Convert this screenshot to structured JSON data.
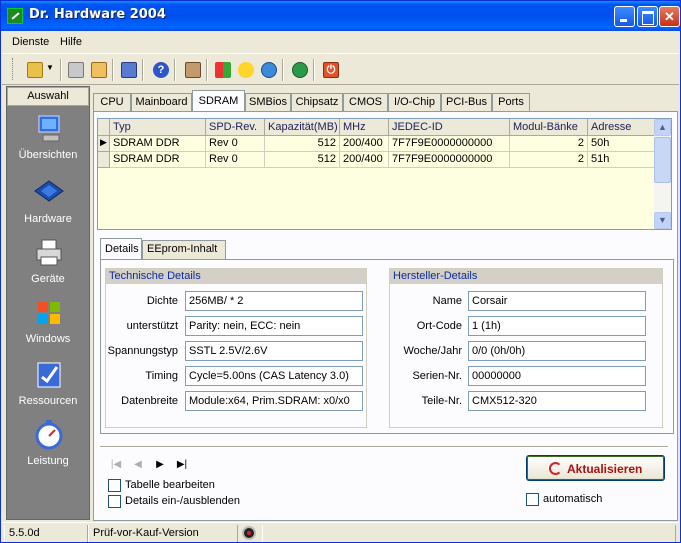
{
  "window": {
    "title": "Dr. Hardware 2004"
  },
  "menu": {
    "items": [
      "Dienste",
      "Hilfe"
    ]
  },
  "toolbar": {
    "buttons": [
      "folder-icon",
      "print-icon",
      "printer-setup-icon",
      "notes-icon",
      "help-icon",
      "tools-icon",
      "windows-icon",
      "sun-icon",
      "globe-icon",
      "network-icon",
      "power-icon"
    ]
  },
  "sidebar": {
    "header": "Auswahl",
    "items": [
      {
        "label": "Übersichten",
        "icon": "computer-icon"
      },
      {
        "label": "Hardware",
        "icon": "chip-icon"
      },
      {
        "label": "Geräte",
        "icon": "printer-icon"
      },
      {
        "label": "Windows",
        "icon": "windows-logo-icon"
      },
      {
        "label": "Ressourcen",
        "icon": "resources-icon"
      },
      {
        "label": "Leistung",
        "icon": "stopwatch-icon"
      }
    ]
  },
  "tabs": [
    "CPU",
    "Mainboard",
    "SDRAM",
    "SMBios",
    "Chipsatz",
    "CMOS",
    "I/O-Chip",
    "PCI-Bus",
    "Ports"
  ],
  "active_tab": "SDRAM",
  "table": {
    "columns": [
      "Typ",
      "SPD-Rev.",
      "Kapazität(MB)",
      "MHz",
      "JEDEC-ID",
      "Modul-Bänke",
      "Adresse"
    ],
    "rows": [
      [
        "SDRAM DDR",
        "Rev 0",
        "512",
        "200/400",
        "7F7F9E0000000000",
        "2",
        "50h"
      ],
      [
        "SDRAM DDR",
        "Rev 0",
        "512",
        "200/400",
        "7F7F9E0000000000",
        "2",
        "51h"
      ]
    ]
  },
  "subtabs": [
    "Details",
    "EEprom-Inhalt"
  ],
  "technical": {
    "title": "Technische Details",
    "fields": [
      {
        "label": "Dichte",
        "value": "256MB/ * 2"
      },
      {
        "label": "unterstützt",
        "value": "Parity: nein, ECC: nein"
      },
      {
        "label": "Spannungstyp",
        "value": "SSTL 2.5V/2.6V"
      },
      {
        "label": "Timing",
        "value": "Cycle=5.00ns (CAS Latency 3.0)"
      },
      {
        "label": "Datenbreite",
        "value": "Module:x64, Prim.SDRAM: x0/x0"
      }
    ]
  },
  "manufacturer": {
    "title": "Hersteller-Details",
    "fields": [
      {
        "label": "Name",
        "value": "Corsair"
      },
      {
        "label": "Ort-Code",
        "value": "1 (1h)"
      },
      {
        "label": "Woche/Jahr",
        "value": "0/0 (0h/0h)"
      },
      {
        "label": "Serien-Nr.",
        "value": "00000000"
      },
      {
        "label": "Teile-Nr.",
        "value": "CMX512-320"
      }
    ]
  },
  "options": {
    "edit_table": "Tabelle bearbeiten",
    "toggle_details": "Details ein-/ausblenden",
    "automatic": "automatisch"
  },
  "refresh_button": "Aktualisieren",
  "status": {
    "version": "5.5.0d",
    "edition": "Prüf-vor-Kauf-Version"
  }
}
